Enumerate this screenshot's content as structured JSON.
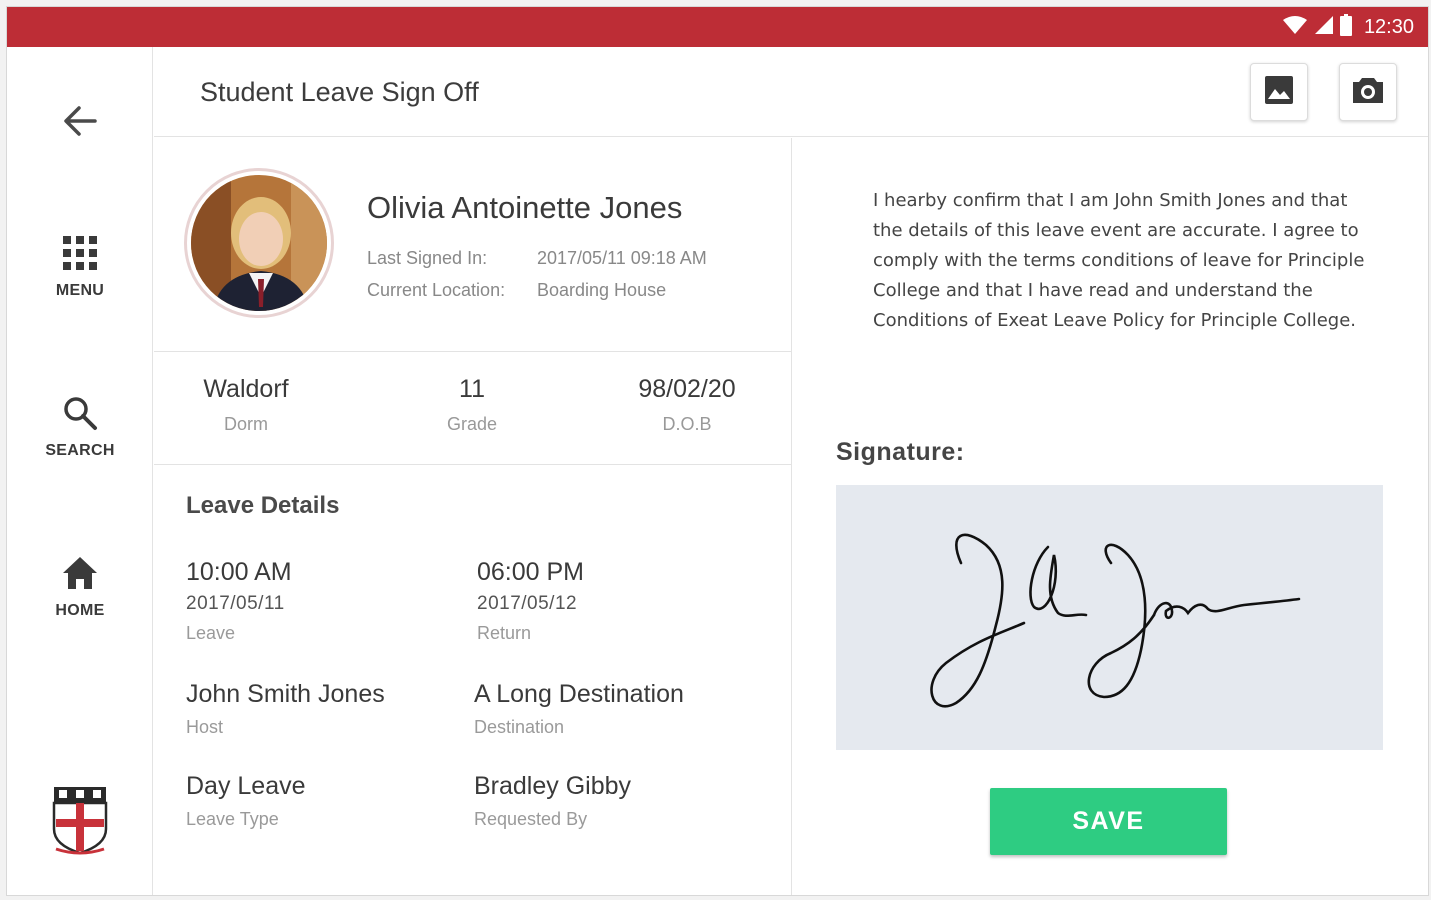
{
  "status_bar": {
    "time": "12:30"
  },
  "header": {
    "title": "Student Leave Sign Off"
  },
  "sidebar": {
    "items": [
      {
        "label": "MENU"
      },
      {
        "label": "SEARCH"
      },
      {
        "label": "HOME"
      }
    ]
  },
  "student": {
    "name": "Olivia Antoinette Jones",
    "last_signed_in_label": "Last Signed In:",
    "last_signed_in_value": "2017/05/11 09:18 AM",
    "location_label": "Current Location:",
    "location_value": "Boarding House"
  },
  "stats": [
    {
      "value": "Waldorf",
      "label": "Dorm"
    },
    {
      "value": "11",
      "label": "Grade"
    },
    {
      "value": "98/02/20",
      "label": "D.O.B"
    }
  ],
  "leave_details": {
    "title": "Leave Details",
    "leave": {
      "time": "10:00 AM",
      "date": "2017/05/11",
      "label": "Leave"
    },
    "return": {
      "time": "06:00 PM",
      "date": "2017/05/12",
      "label": "Return"
    },
    "host": {
      "value": "John Smith Jones",
      "label": "Host"
    },
    "destination": {
      "value": "A Long Destination",
      "label": "Destination"
    },
    "leave_type": {
      "value": "Day Leave",
      "label": "Leave Type"
    },
    "requested_by": {
      "value": "Bradley Gibby",
      "label": "Requested By"
    }
  },
  "consent": {
    "text": "I hearby confirm that I am John Smith Jones and that the details of this leave event are accurate.  I agree to comply with the terms conditions of leave for Principle College and that I have read and understand the Conditions of Exeat Leave Policy for Principle College."
  },
  "signature": {
    "label": "Signature:",
    "save_label": "SAVE"
  },
  "colors": {
    "status_bar": "#bd2d36",
    "save_button": "#2ecc82",
    "signature_pad": "#e5e9ef"
  },
  "icons": [
    "back-arrow-icon",
    "grid-menu-icon",
    "search-icon",
    "home-icon",
    "image-icon",
    "camera-icon",
    "wifi-icon",
    "signal-icon",
    "battery-icon"
  ]
}
